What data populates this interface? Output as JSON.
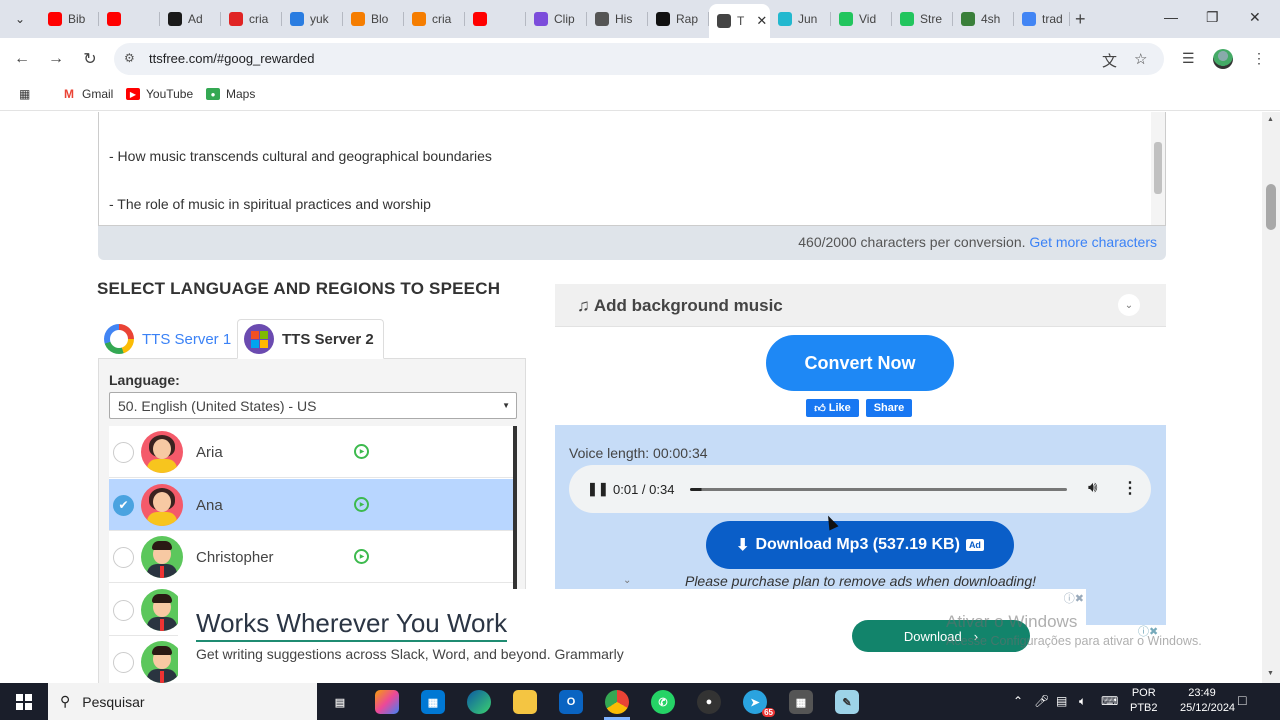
{
  "browser": {
    "tabs": [
      {
        "label": "Bib",
        "icon": "youtube-icon",
        "color": "#ff0000"
      },
      {
        "label": "",
        "icon": "youtube-icon",
        "color": "#ff0000"
      },
      {
        "label": "Ad",
        "icon": "adobe-icon",
        "color": "#1a1a1a"
      },
      {
        "label": "cria",
        "icon": "canva-icon",
        "color": "#e02424"
      },
      {
        "label": "yuk",
        "icon": "u-icon",
        "color": "#2a7de1"
      },
      {
        "label": "Blo",
        "icon": "blogger-icon",
        "color": "#f57d00"
      },
      {
        "label": "cria",
        "icon": "blogger-icon",
        "color": "#f57d00"
      },
      {
        "label": "",
        "icon": "youtube-icon",
        "color": "#ff0000"
      },
      {
        "label": "Clip",
        "icon": "clipchamp-icon",
        "color": "#7c4ddb"
      },
      {
        "label": "His",
        "icon": "openai-icon",
        "color": "#555555"
      },
      {
        "label": "Rap",
        "icon": "r-icon",
        "color": "#111111"
      },
      {
        "label": "T",
        "icon": "speaker-icon",
        "color": "#444444",
        "active": true
      },
      {
        "label": "Jun",
        "icon": "play-icon",
        "color": "#22b8cf"
      },
      {
        "label": "Vid",
        "icon": "puzzle-icon",
        "color": "#22c55e"
      },
      {
        "label": "Stre",
        "icon": "puzzle-icon",
        "color": "#22c55e"
      },
      {
        "label": "4sh",
        "icon": "4shared-icon",
        "color": "#3a7f3a"
      },
      {
        "label": "trad",
        "icon": "google-icon",
        "color": "#4285f4"
      }
    ],
    "url": "ttsfree.com/#goog_rewarded",
    "bookmarks": [
      {
        "label": "Gmail",
        "icon": "gmail-icon"
      },
      {
        "label": "YouTube",
        "icon": "youtube-icon"
      },
      {
        "label": "Maps",
        "icon": "maps-icon"
      }
    ]
  },
  "editor": {
    "lines": [
      "- How music transcends cultural and geographical boundaries",
      "- The role of music in spiritual practices and worship"
    ],
    "counter_text": "460/2000 characters per conversion.",
    "counter_link": "Get more characters"
  },
  "language_section": {
    "title": "SELECT LANGUAGE AND REGIONS TO SPEECH",
    "server1": "TTS Server 1",
    "server2": "TTS Server 2",
    "language_label": "Language:",
    "language_value": "50. English (United States) - US",
    "voices": [
      {
        "name": "Aria",
        "gender": "female",
        "selected": false,
        "play": true
      },
      {
        "name": "Ana",
        "gender": "female",
        "selected": true,
        "play": true
      },
      {
        "name": "Christopher",
        "gender": "male",
        "selected": false,
        "play": true
      },
      {
        "name": "",
        "gender": "male",
        "selected": false,
        "play": false
      },
      {
        "name": "",
        "gender": "male",
        "selected": false,
        "play": false
      }
    ]
  },
  "right_panel": {
    "bg_music_label": "Add background music",
    "convert_label": "Convert Now",
    "fb_like": "Like",
    "fb_share": "Share",
    "voice_length": "Voice length: 00:00:34",
    "player_time": "0:01 / 0:34",
    "player_progress": 0.03,
    "download_label": "Download Mp3 (537.19 KB)",
    "download_ad_tag": "Ad",
    "purchase_note": "Please purchase plan to remove ads when downloading!"
  },
  "ad": {
    "headline": "Works Wherever You Work",
    "sub": "Get writing suggestions across Slack, Word, and beyond. Grammarly",
    "button": "Download"
  },
  "watermark": {
    "line1": "Ativar o Windows",
    "line2": "Acesse Configurações para ativar o Windows."
  },
  "taskbar": {
    "search_placeholder": "Pesquisar",
    "lang_top": "POR",
    "lang_bottom": "PTB2",
    "time": "23:49",
    "date": "25/12/2024",
    "telegram_badge": "65"
  }
}
